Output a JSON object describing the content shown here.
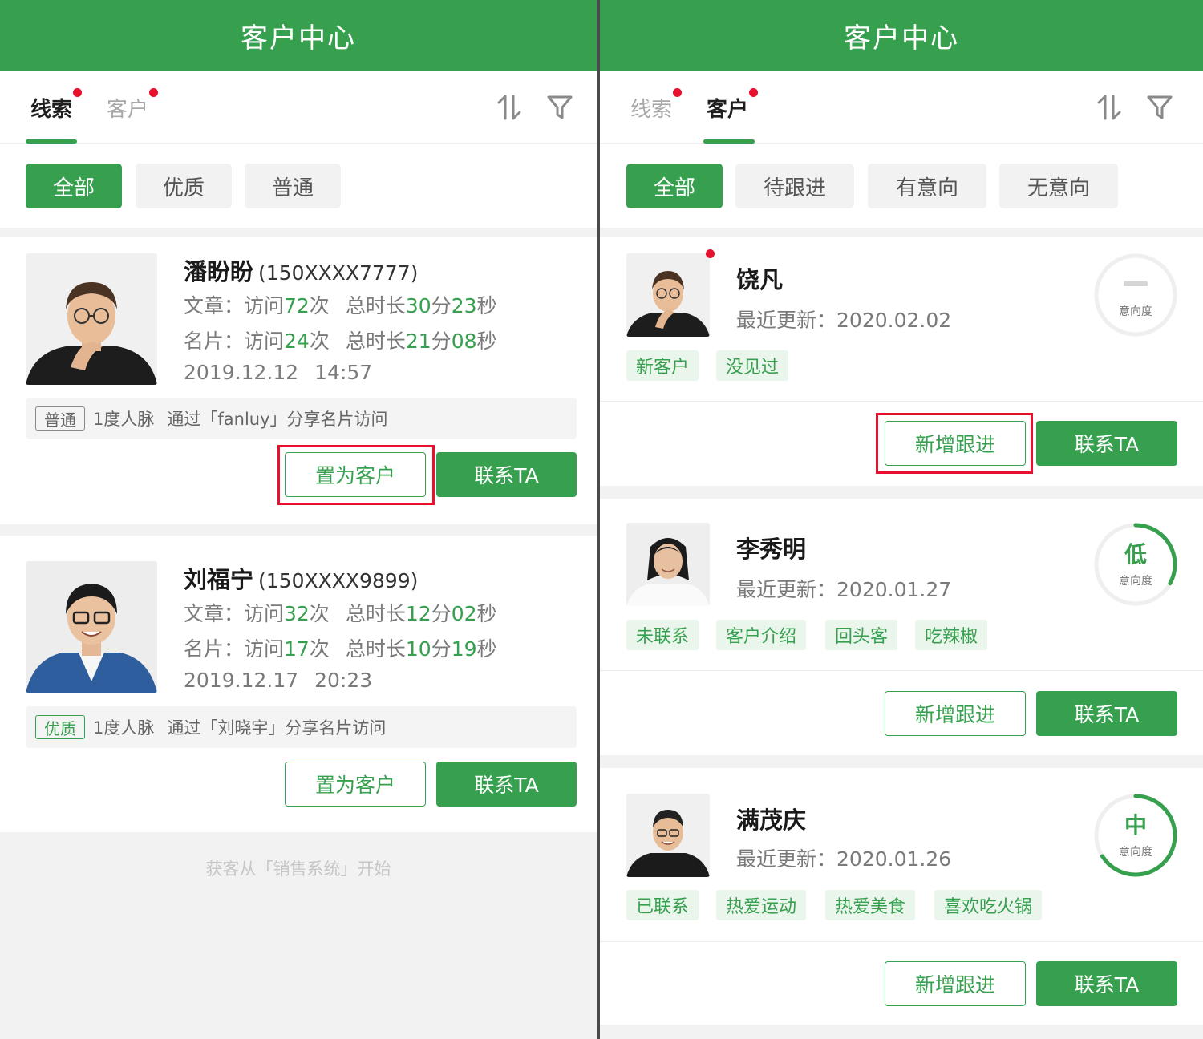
{
  "colors": {
    "primary": "#36a04f",
    "dot": "#e8112d",
    "tag_bg": "#eaf6ec",
    "page_bg": "#f2f2f2"
  },
  "left": {
    "header": {
      "title": "客户中心"
    },
    "tabs": [
      {
        "label": "线索",
        "active": true,
        "dot": true
      },
      {
        "label": "客户",
        "active": false,
        "dot": true
      }
    ],
    "tools": {
      "sort_icon": "sort-icon",
      "filter_icon": "filter-icon"
    },
    "filters": [
      {
        "label": "全部",
        "active": true
      },
      {
        "label": "优质",
        "active": false
      },
      {
        "label": "普通",
        "active": false
      }
    ],
    "leads": [
      {
        "name": "潘盼盼",
        "phone": "(150XXXX7777)",
        "article": {
          "prefix": "文章：访问",
          "visits": "72",
          "visits_unit": "次",
          "duration_prefix": "总时长",
          "min": "30",
          "min_unit": "分",
          "sec": "23",
          "sec_unit": "秒"
        },
        "card": {
          "prefix": "名片：访问",
          "visits": "24",
          "visits_unit": "次",
          "duration_prefix": "总时长",
          "min": "21",
          "min_unit": "分",
          "sec": "08",
          "sec_unit": "秒"
        },
        "date": "2019.12.12",
        "time": "14:57",
        "level": "普通",
        "degree": "1度人脉",
        "source": "通过「fanluy」分享名片访问",
        "btn_set": "置为客户",
        "btn_contact": "联系TA"
      },
      {
        "name": "刘福宁",
        "phone": "(150XXXX9899)",
        "article": {
          "prefix": "文章：访问",
          "visits": "32",
          "visits_unit": "次",
          "duration_prefix": "总时长",
          "min": "12",
          "min_unit": "分",
          "sec": "02",
          "sec_unit": "秒"
        },
        "card": {
          "prefix": "名片：访问",
          "visits": "17",
          "visits_unit": "次",
          "duration_prefix": "总时长",
          "min": "10",
          "min_unit": "分",
          "sec": "19",
          "sec_unit": "秒"
        },
        "date": "2019.12.17",
        "time": "20:23",
        "level": "优质",
        "degree": "1度人脉",
        "source": "通过「刘晓宇」分享名片访问",
        "btn_set": "置为客户",
        "btn_contact": "联系TA"
      }
    ],
    "footer": "获客从「销售系统」开始"
  },
  "right": {
    "header": {
      "title": "客户中心"
    },
    "tabs": [
      {
        "label": "线索",
        "active": false,
        "dot": true
      },
      {
        "label": "客户",
        "active": true,
        "dot": true
      }
    ],
    "tools": {
      "sort_icon": "sort-icon",
      "filter_icon": "filter-icon"
    },
    "filters": [
      {
        "label": "全部",
        "active": true
      },
      {
        "label": "待跟进",
        "active": false
      },
      {
        "label": "有意向",
        "active": false
      },
      {
        "label": "无意向",
        "active": false
      }
    ],
    "customers": [
      {
        "name": "饶凡",
        "update_label": "最近更新：",
        "update_date": "2020.02.02",
        "unread": true,
        "intent": {
          "value": "",
          "label": "意向度",
          "level": 0
        },
        "tags": [
          "新客户",
          "没见过"
        ],
        "btn_follow": "新增跟进",
        "btn_contact": "联系TA"
      },
      {
        "name": "李秀明",
        "update_label": "最近更新：",
        "update_date": "2020.01.27",
        "unread": false,
        "intent": {
          "value": "低",
          "label": "意向度",
          "level": 0.33
        },
        "tags": [
          "未联系",
          "客户介绍",
          "回头客",
          "吃辣椒"
        ],
        "btn_follow": "新增跟进",
        "btn_contact": "联系TA"
      },
      {
        "name": "满茂庆",
        "update_label": "最近更新：",
        "update_date": "2020.01.26",
        "unread": false,
        "intent": {
          "value": "中",
          "label": "意向度",
          "level": 0.66
        },
        "tags": [
          "已联系",
          "热爱运动",
          "热爱美食",
          "喜欢吃火锅"
        ],
        "btn_follow": "新增跟进",
        "btn_contact": "联系TA"
      }
    ]
  }
}
